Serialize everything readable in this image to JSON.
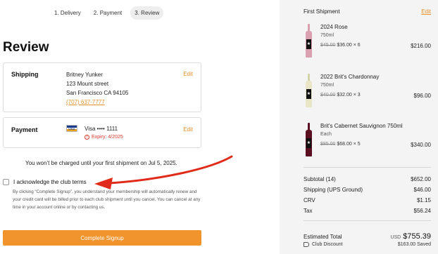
{
  "steps": [
    {
      "label": "1. Delivery"
    },
    {
      "label": "2. Payment"
    },
    {
      "label": "3. Review"
    }
  ],
  "page_title": "Review",
  "shipping": {
    "label": "Shipping",
    "name": "Britney Yunker",
    "street": "123 Mount street",
    "city_line": "San Francisco CA 94105",
    "phone": "(707) 637-7777",
    "edit_label": "Edit"
  },
  "payment": {
    "label": "Payment",
    "card_brand": "VISA",
    "card_text": "Visa •••• 1111",
    "expiry_text": "Expiry: 4/2025",
    "edit_label": "Edit"
  },
  "charge_note": "You won’t be charged until your first shipment on Jul 5, 2025.",
  "acknowledge": {
    "label": "I acknowledge the club terms",
    "help": "By clicking “Complete Signup”, you understand your membership will automatically renew and your credit card will be billed prior to each club shipment until you cancel. You can cancel at any time in your account online or by contacting us."
  },
  "complete_button": "Complete Signup",
  "summary": {
    "header": "First Shipment",
    "edit_label": "Edit",
    "items": [
      {
        "name": "2024 Rose",
        "size": "750ml",
        "orig_price": "$45.00",
        "price": "$36.00",
        "qty": "× 6",
        "line_total": "$216.00",
        "bottle_color": "#d9a0b0"
      },
      {
        "name": "2022 Brit's Chardonnay",
        "size": "750ml",
        "orig_price": "$40.00",
        "price": "$32.00",
        "qty": "× 3",
        "line_total": "$96.00",
        "bottle_color": "#e9e6c8"
      },
      {
        "name": "Brit's Cabernet Sauvignon 750ml",
        "size": "Each",
        "orig_price": "$85.00",
        "price": "$68.00",
        "qty": "× 5",
        "line_total": "$340.00",
        "bottle_color": "#5a1020"
      }
    ],
    "subtotal_label": "Subtotal (14)",
    "subtotal": "$652.00",
    "shipping_label": "Shipping (UPS Ground)",
    "shipping": "$46.00",
    "crv_label": "CRV",
    "crv": "$1.15",
    "tax_label": "Tax",
    "tax": "$56.24",
    "total_label": "Estimated Total",
    "total_currency": "USD",
    "total": "$755.39",
    "discount_label": "Club Discount",
    "discount": "$163.00 Saved"
  },
  "colors": {
    "accent": "#f0942b",
    "link": "#e8912d",
    "error": "#d63a2a",
    "arrow": "#e02a1a"
  }
}
